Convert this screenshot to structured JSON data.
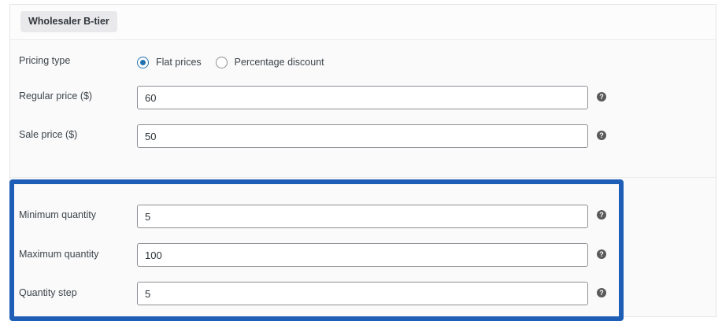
{
  "tier": {
    "name": "Wholesaler B-tier"
  },
  "pricing_type": {
    "label": "Pricing type",
    "options": [
      {
        "label": "Flat prices",
        "checked": true
      },
      {
        "label": "Percentage discount",
        "checked": false
      }
    ]
  },
  "regular_price": {
    "label": "Regular price ($)",
    "value": "60"
  },
  "sale_price": {
    "label": "Sale price ($)",
    "value": "50"
  },
  "min_quantity": {
    "label": "Minimum quantity",
    "value": "5"
  },
  "max_quantity": {
    "label": "Maximum quantity",
    "value": "100"
  },
  "quantity_step": {
    "label": "Quantity step",
    "value": "5"
  },
  "help_glyph": "?",
  "colors": {
    "accent": "#2271b1",
    "highlight_border": "#1f5eb7",
    "help_icon": "#5a5a5a"
  }
}
